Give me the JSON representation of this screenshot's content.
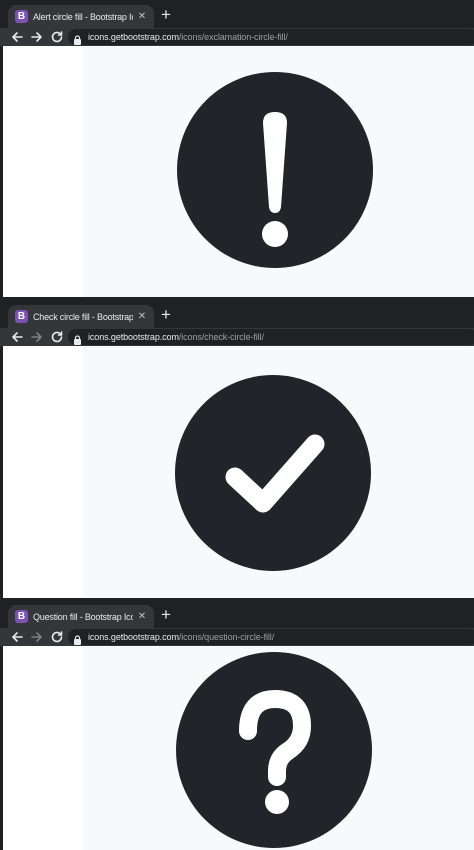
{
  "colors": {
    "chrome_dark": "#202124",
    "chrome_toolbar": "#35363a",
    "bootstrap_purple": "#7952b3",
    "icon_fill": "#212529",
    "page_bg": "#f8f9fa"
  },
  "favicon_letter": "B",
  "new_tab_icon": "plus-icon",
  "close_icon": "close-icon",
  "screenshots": [
    {
      "tab_title": "Alert circle fill - Bootstrap Icons",
      "url_host": "icons.getbootstrap.com",
      "url_path": "/icons/exclamation-circle-fill/",
      "icon": "exclamation-circle-fill-icon",
      "forward_enabled": true
    },
    {
      "tab_title": "Check circle fill - Bootstrap Icons",
      "url_host": "icons.getbootstrap.com",
      "url_path": "/icons/check-circle-fill/",
      "icon": "check-circle-fill-icon",
      "forward_enabled": false
    },
    {
      "tab_title": "Question fill - Bootstrap Icons",
      "url_host": "icons.getbootstrap.com",
      "url_path": "/icons/question-circle-fill/",
      "icon": "question-circle-fill-icon",
      "forward_enabled": false
    }
  ]
}
